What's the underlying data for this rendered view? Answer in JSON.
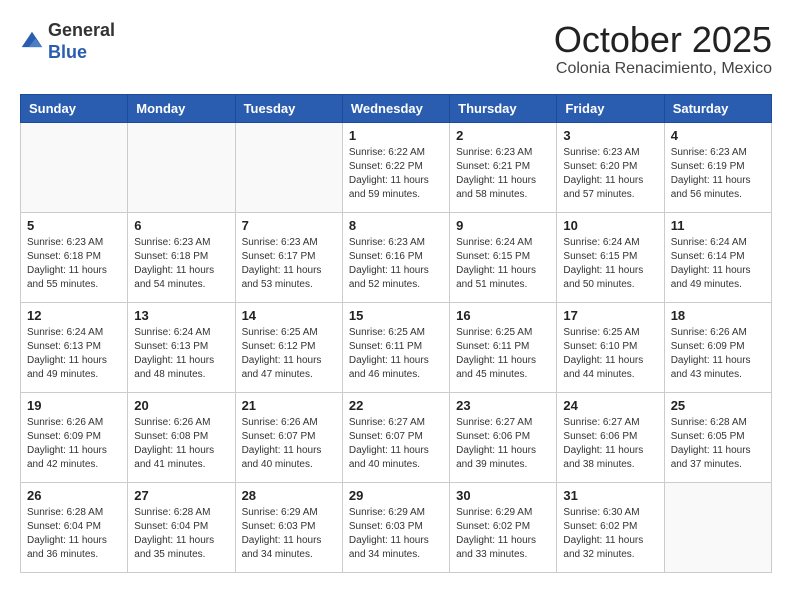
{
  "header": {
    "logo": {
      "line1": "General",
      "line2": "Blue"
    },
    "month": "October 2025",
    "location": "Colonia Renacimiento, Mexico"
  },
  "weekdays": [
    "Sunday",
    "Monday",
    "Tuesday",
    "Wednesday",
    "Thursday",
    "Friday",
    "Saturday"
  ],
  "weeks": [
    [
      {
        "day": "",
        "info": ""
      },
      {
        "day": "",
        "info": ""
      },
      {
        "day": "",
        "info": ""
      },
      {
        "day": "1",
        "info": "Sunrise: 6:22 AM\nSunset: 6:22 PM\nDaylight: 11 hours\nand 59 minutes."
      },
      {
        "day": "2",
        "info": "Sunrise: 6:23 AM\nSunset: 6:21 PM\nDaylight: 11 hours\nand 58 minutes."
      },
      {
        "day": "3",
        "info": "Sunrise: 6:23 AM\nSunset: 6:20 PM\nDaylight: 11 hours\nand 57 minutes."
      },
      {
        "day": "4",
        "info": "Sunrise: 6:23 AM\nSunset: 6:19 PM\nDaylight: 11 hours\nand 56 minutes."
      }
    ],
    [
      {
        "day": "5",
        "info": "Sunrise: 6:23 AM\nSunset: 6:18 PM\nDaylight: 11 hours\nand 55 minutes."
      },
      {
        "day": "6",
        "info": "Sunrise: 6:23 AM\nSunset: 6:18 PM\nDaylight: 11 hours\nand 54 minutes."
      },
      {
        "day": "7",
        "info": "Sunrise: 6:23 AM\nSunset: 6:17 PM\nDaylight: 11 hours\nand 53 minutes."
      },
      {
        "day": "8",
        "info": "Sunrise: 6:23 AM\nSunset: 6:16 PM\nDaylight: 11 hours\nand 52 minutes."
      },
      {
        "day": "9",
        "info": "Sunrise: 6:24 AM\nSunset: 6:15 PM\nDaylight: 11 hours\nand 51 minutes."
      },
      {
        "day": "10",
        "info": "Sunrise: 6:24 AM\nSunset: 6:15 PM\nDaylight: 11 hours\nand 50 minutes."
      },
      {
        "day": "11",
        "info": "Sunrise: 6:24 AM\nSunset: 6:14 PM\nDaylight: 11 hours\nand 49 minutes."
      }
    ],
    [
      {
        "day": "12",
        "info": "Sunrise: 6:24 AM\nSunset: 6:13 PM\nDaylight: 11 hours\nand 49 minutes."
      },
      {
        "day": "13",
        "info": "Sunrise: 6:24 AM\nSunset: 6:13 PM\nDaylight: 11 hours\nand 48 minutes."
      },
      {
        "day": "14",
        "info": "Sunrise: 6:25 AM\nSunset: 6:12 PM\nDaylight: 11 hours\nand 47 minutes."
      },
      {
        "day": "15",
        "info": "Sunrise: 6:25 AM\nSunset: 6:11 PM\nDaylight: 11 hours\nand 46 minutes."
      },
      {
        "day": "16",
        "info": "Sunrise: 6:25 AM\nSunset: 6:11 PM\nDaylight: 11 hours\nand 45 minutes."
      },
      {
        "day": "17",
        "info": "Sunrise: 6:25 AM\nSunset: 6:10 PM\nDaylight: 11 hours\nand 44 minutes."
      },
      {
        "day": "18",
        "info": "Sunrise: 6:26 AM\nSunset: 6:09 PM\nDaylight: 11 hours\nand 43 minutes."
      }
    ],
    [
      {
        "day": "19",
        "info": "Sunrise: 6:26 AM\nSunset: 6:09 PM\nDaylight: 11 hours\nand 42 minutes."
      },
      {
        "day": "20",
        "info": "Sunrise: 6:26 AM\nSunset: 6:08 PM\nDaylight: 11 hours\nand 41 minutes."
      },
      {
        "day": "21",
        "info": "Sunrise: 6:26 AM\nSunset: 6:07 PM\nDaylight: 11 hours\nand 40 minutes."
      },
      {
        "day": "22",
        "info": "Sunrise: 6:27 AM\nSunset: 6:07 PM\nDaylight: 11 hours\nand 40 minutes."
      },
      {
        "day": "23",
        "info": "Sunrise: 6:27 AM\nSunset: 6:06 PM\nDaylight: 11 hours\nand 39 minutes."
      },
      {
        "day": "24",
        "info": "Sunrise: 6:27 AM\nSunset: 6:06 PM\nDaylight: 11 hours\nand 38 minutes."
      },
      {
        "day": "25",
        "info": "Sunrise: 6:28 AM\nSunset: 6:05 PM\nDaylight: 11 hours\nand 37 minutes."
      }
    ],
    [
      {
        "day": "26",
        "info": "Sunrise: 6:28 AM\nSunset: 6:04 PM\nDaylight: 11 hours\nand 36 minutes."
      },
      {
        "day": "27",
        "info": "Sunrise: 6:28 AM\nSunset: 6:04 PM\nDaylight: 11 hours\nand 35 minutes."
      },
      {
        "day": "28",
        "info": "Sunrise: 6:29 AM\nSunset: 6:03 PM\nDaylight: 11 hours\nand 34 minutes."
      },
      {
        "day": "29",
        "info": "Sunrise: 6:29 AM\nSunset: 6:03 PM\nDaylight: 11 hours\nand 34 minutes."
      },
      {
        "day": "30",
        "info": "Sunrise: 6:29 AM\nSunset: 6:02 PM\nDaylight: 11 hours\nand 33 minutes."
      },
      {
        "day": "31",
        "info": "Sunrise: 6:30 AM\nSunset: 6:02 PM\nDaylight: 11 hours\nand 32 minutes."
      },
      {
        "day": "",
        "info": ""
      }
    ]
  ]
}
